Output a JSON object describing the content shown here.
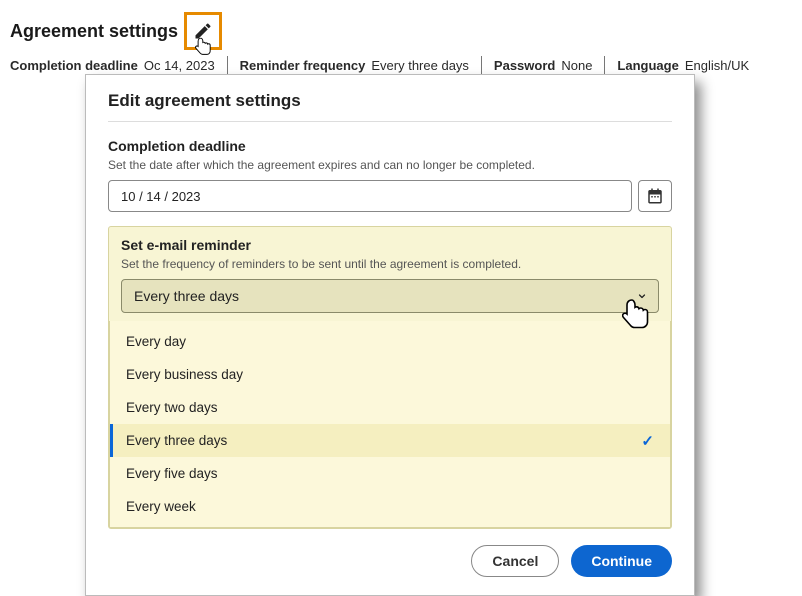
{
  "header": {
    "title": "Agreement settings",
    "summary": {
      "deadline_label": "Completion deadline",
      "deadline_value": "October 14, 2023",
      "deadline_value_obscured": "Oc       14, 2023",
      "reminder_label": "Reminder frequency",
      "reminder_value": "Every three days",
      "password_label": "Password",
      "password_value": "None",
      "language_label": "Language",
      "language_value": "English/UK"
    }
  },
  "dialog": {
    "title": "Edit agreement settings",
    "deadline": {
      "label": "Completion deadline",
      "help": "Set the date after which the agreement expires and can no longer be completed.",
      "value": "10 / 14 / 2023"
    },
    "reminder": {
      "label": "Set e-mail reminder",
      "help": "Set the frequency of reminders to be sent until the agreement is completed.",
      "selected": "Every three days",
      "options": [
        "Every day",
        "Every business day",
        "Every two days",
        "Every three days",
        "Every five days",
        "Every week"
      ]
    },
    "buttons": {
      "cancel": "Cancel",
      "continue": "Continue"
    }
  }
}
